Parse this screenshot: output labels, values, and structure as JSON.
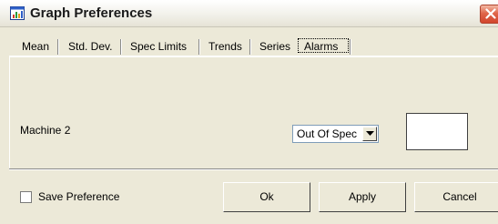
{
  "window": {
    "title": "Graph Preferences",
    "app_icon": "graph-app-icon",
    "close_icon": "close-icon"
  },
  "tabs": [
    {
      "label": "Mean",
      "active": false
    },
    {
      "label": "Std. Dev.",
      "active": false
    },
    {
      "label": "Spec Limits",
      "active": false
    },
    {
      "label": "Trends",
      "active": false
    },
    {
      "label": "Series",
      "active": false
    },
    {
      "label": "Alarms",
      "active": true
    }
  ],
  "alarms": {
    "machine_label": "Machine 2",
    "alarm_select": {
      "value": "Out Of Spec",
      "icon": "chevron-down-icon"
    },
    "alarm_color_box": "#ffffff"
  },
  "footer": {
    "save_preference_label": "Save Preference",
    "save_preference_checked": false,
    "ok_label": "Ok",
    "apply_label": "Apply",
    "cancel_label": "Cancel"
  },
  "colors": {
    "dialog_bg": "#ece9d8",
    "close_button": "#d2452c"
  }
}
